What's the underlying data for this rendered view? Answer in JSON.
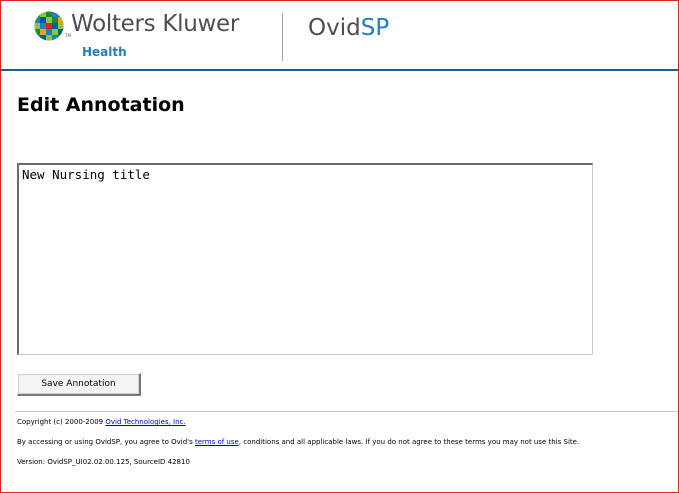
{
  "header": {
    "brand_name": "Wolters Kluwer",
    "brand_trademark": "TM",
    "brand_sub": "Health",
    "product_prefix": "Ovid",
    "product_suffix": "SP"
  },
  "page": {
    "title": "Edit Annotation"
  },
  "annotation": {
    "text": "New Nursing title"
  },
  "buttons": {
    "save_label": "Save Annotation"
  },
  "footer": {
    "copyright_prefix": "Copyright (c) 2000-2009 ",
    "copyright_link": "Ovid Technologies, Inc.",
    "terms_prefix": "By accessing or using OvidSP, you agree to Ovid's ",
    "terms_link": "terms of use",
    "terms_suffix": ", conditions and all applicable laws. If you do not agree to these terms you may not use this Site.",
    "version": "Version: OvidSP_UI02.02.00.125, SourceID 42810"
  },
  "colors": {
    "frame_border": "#e0201c",
    "header_rule": "#1f5d86",
    "brand_blue": "#1f7fbf",
    "link": "#0000cc"
  }
}
